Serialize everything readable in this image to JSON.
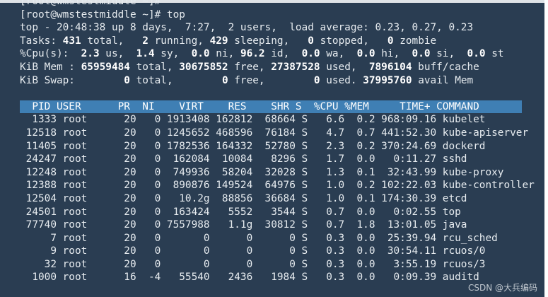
{
  "prompt_lines": [
    "[root@wmstestmiddle ~]#",
    "[root@wmstestmiddle ~]# top"
  ],
  "summary": {
    "uptime": "top - 20:48:38 up 8 days,  7:27,  2 users,  load average: 0.23, 0.27, 0.23",
    "tasks": {
      "label": "Tasks: ",
      "total": "431",
      "total_label": " total,   ",
      "running": "2",
      "running_label": " running, ",
      "sleeping": "429",
      "sleeping_label": " sleeping,   ",
      "stopped": "0",
      "stopped_label": " stopped,   ",
      "zombie": "0",
      "zombie_label": " zombie"
    },
    "cpu": {
      "label": "%Cpu(s):  ",
      "us": "2.3",
      "us_label": " us,  ",
      "sy": "1.4",
      "sy_label": " sy,  ",
      "ni": "0.0",
      "ni_label": " ni, ",
      "id": "96.2",
      "id_label": " id,  ",
      "wa": "0.0",
      "wa_label": " wa,  ",
      "hi": "0.0",
      "hi_label": " hi,  ",
      "si": "0.0",
      "si_label": " si,  ",
      "st": "0.0",
      "st_label": " st"
    },
    "mem": {
      "label": "KiB Mem : ",
      "total": "65959484",
      "total_label": " total, ",
      "free": "30675852",
      "free_label": " free, ",
      "used": "27387528",
      "used_label": " used,  ",
      "buff": "7896104",
      "buff_label": " buff/cache"
    },
    "swap": {
      "label": "KiB Swap:        ",
      "total": "0",
      "total_label": " total,        ",
      "free": "0",
      "free_label": " free,        ",
      "used": "0",
      "used_label": " used. ",
      "avail": "37995760",
      "avail_label": " avail Mem"
    }
  },
  "table": {
    "header": "  PID USER      PR  NI    VIRT    RES    SHR S  %CPU %MEM     TIME+ COMMAND         ",
    "rows": [
      "  1333 root      20   0 1913408 162812  68664 S   6.6  0.2 968:09.16 kubelet",
      " 12518 root      20   0 1245652 468596  76184 S   4.7  0.7 441:52.30 kube-apiserver",
      " 11405 root      20   0 1782536 164332  52780 S   2.3  0.2 370:24.69 dockerd",
      " 24247 root      20   0  162084  10084   8296 S   1.7  0.0   0:11.27 sshd",
      " 12248 root      20   0  749936  58204  32028 S   1.3  0.1  32:43.99 kube-proxy",
      " 12388 root      20   0  890876 149524  64976 S   1.0  0.2 102:22.03 kube-controller",
      " 12504 root      20   0   10.2g  88856  36684 S   1.0  0.1 174:30.39 etcd",
      " 24501 root      20   0  163424   5552   3544 S   0.7  0.0   0:02.55 top",
      " 77740 root      20   0 7557988   1.1g  30812 S   0.7  1.8  13:01.05 java",
      "     7 root      20   0       0      0      0 S   0.3  0.0  25:39.94 rcu_sched",
      "     9 root      20   0       0      0      0 S   0.3  0.0  30:54.11 rcuos/0",
      "    32 root      20   0       0      0      0 S   0.3  0.0   3:55.19 rcuos/3",
      "  1000 root      16  -4   55540   2436   1984 S   0.3  0.0   0:09.39 auditd"
    ]
  },
  "watermark": "CSDN @大兵编码",
  "colors": {
    "background": "#2a3d52",
    "header_bg": "#3f7fb4",
    "text": "#e6ebef"
  }
}
